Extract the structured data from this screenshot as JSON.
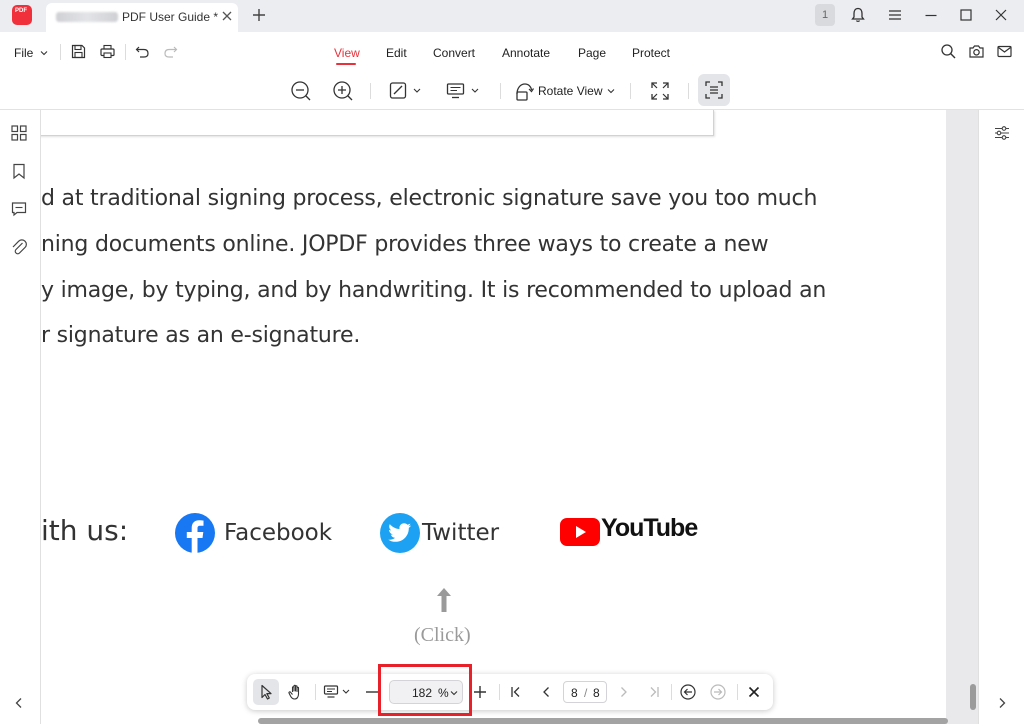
{
  "window": {
    "tab_title": "PDF User Guide *",
    "app_logo_text": "PDF",
    "notification_count": "1",
    "icons": [
      "bell-icon",
      "hamburger-menu-icon",
      "minimize-icon",
      "maximize-icon",
      "close-icon"
    ]
  },
  "menubar": {
    "file_label": "File",
    "tabs": [
      {
        "label": "View",
        "active": true
      },
      {
        "label": "Edit",
        "active": false
      },
      {
        "label": "Convert",
        "active": false
      },
      {
        "label": "Annotate",
        "active": false
      },
      {
        "label": "Page",
        "active": false
      },
      {
        "label": "Protect",
        "active": false
      }
    ],
    "icons": [
      "save-icon",
      "print-icon",
      "undo-icon",
      "redo-icon",
      "search-icon",
      "camera-icon",
      "mail-icon"
    ]
  },
  "toolbar": {
    "rotate_label": "Rotate View",
    "icons": [
      "zoom-out-icon",
      "zoom-in-icon",
      "page-fit-icon",
      "display-mode-icon",
      "rotate-view-icon",
      "fullscreen-icon",
      "focus-mode-icon"
    ]
  },
  "left_sidebar": {
    "icons": [
      "thumbnails-icon",
      "bookmark-icon",
      "comment-icon",
      "attachment-icon",
      "chevron-left-icon"
    ]
  },
  "document": {
    "lines": [
      "d at traditional signing process, electronic signature save you too much",
      "ning documents online. JOPDF provides three ways to create a new",
      "y image, by typing, and by handwriting. It is recommended to upload an",
      "r signature as an e-signature."
    ],
    "follow_label": "ith us:",
    "social": [
      {
        "name": "Facebook",
        "icon": "facebook-icon",
        "color": "#1877f2"
      },
      {
        "name": "Twitter",
        "icon": "twitter-icon",
        "color": "#1da1f2"
      },
      {
        "name": "YouTube",
        "icon": "youtube-icon",
        "color": "#ff0000"
      }
    ],
    "click_hint": "(Click)"
  },
  "bottombar": {
    "zoom_value": "182",
    "zoom_unit": "%",
    "current_page": "8",
    "page_separator": "/",
    "total_pages": "8",
    "icons": [
      "select-arrow-icon",
      "hand-icon",
      "page-layout-icon",
      "minus-icon",
      "plus-icon",
      "first-page-icon",
      "prev-page-icon",
      "next-page-icon",
      "last-page-icon",
      "back-icon",
      "forward-icon",
      "close-icon"
    ]
  },
  "colors": {
    "accent": "#e8313a",
    "highlight": "#e8202a"
  }
}
